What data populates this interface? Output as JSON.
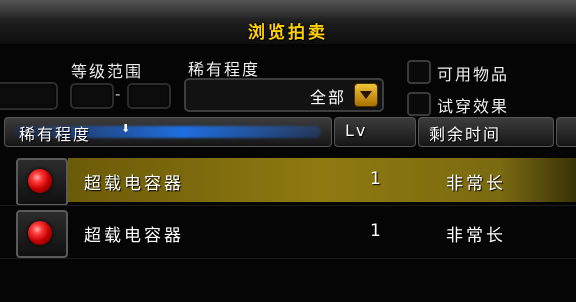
{
  "window": {
    "title": "浏览拍卖"
  },
  "filters": {
    "level_range_label": "等级范围",
    "level_separator": "-",
    "rarity_label": "稀有程度",
    "rarity_selected": "全部",
    "usable_items_label": "可用物品",
    "try_on_label": "试穿效果"
  },
  "table": {
    "columns": [
      {
        "label": "稀有程度"
      },
      {
        "label": "Lv"
      },
      {
        "label": "剩余时间"
      }
    ],
    "sort_indicator": "⬇",
    "rows": [
      {
        "name": "超载电容器",
        "level": "1",
        "time_left": "非常长",
        "icon": "red-gem-icon",
        "selected": true
      },
      {
        "name": "超载电容器",
        "level": "1",
        "time_left": "非常长",
        "icon": "red-gem-icon",
        "selected": false
      }
    ]
  },
  "colors": {
    "title": "#ffd100",
    "selected_row": "#8f7a10",
    "rarity_bar": "#1f6fe0"
  }
}
